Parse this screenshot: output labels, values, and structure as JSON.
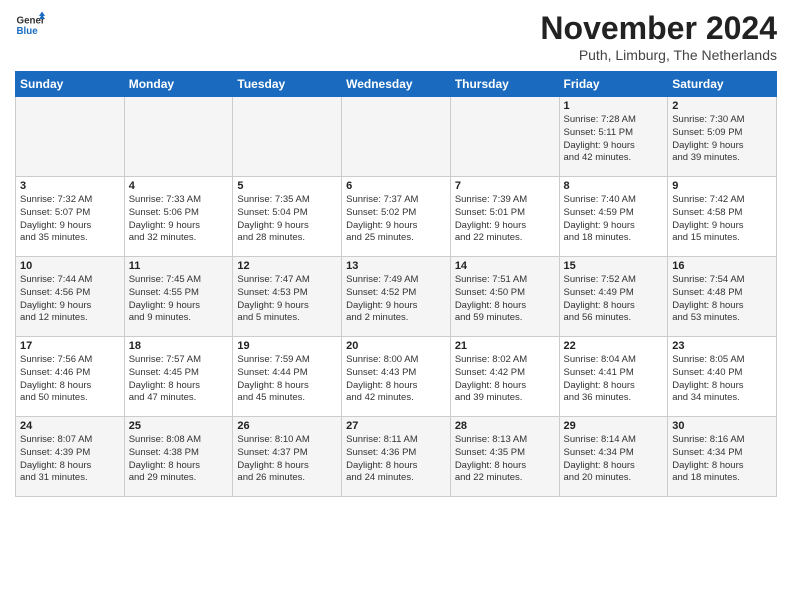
{
  "logo": {
    "line1": "General",
    "line2": "Blue"
  },
  "title": "November 2024",
  "subtitle": "Puth, Limburg, The Netherlands",
  "days_of_week": [
    "Sunday",
    "Monday",
    "Tuesday",
    "Wednesday",
    "Thursday",
    "Friday",
    "Saturday"
  ],
  "weeks": [
    [
      {
        "day": "",
        "info": ""
      },
      {
        "day": "",
        "info": ""
      },
      {
        "day": "",
        "info": ""
      },
      {
        "day": "",
        "info": ""
      },
      {
        "day": "",
        "info": ""
      },
      {
        "day": "1",
        "info": "Sunrise: 7:28 AM\nSunset: 5:11 PM\nDaylight: 9 hours\nand 42 minutes."
      },
      {
        "day": "2",
        "info": "Sunrise: 7:30 AM\nSunset: 5:09 PM\nDaylight: 9 hours\nand 39 minutes."
      }
    ],
    [
      {
        "day": "3",
        "info": "Sunrise: 7:32 AM\nSunset: 5:07 PM\nDaylight: 9 hours\nand 35 minutes."
      },
      {
        "day": "4",
        "info": "Sunrise: 7:33 AM\nSunset: 5:06 PM\nDaylight: 9 hours\nand 32 minutes."
      },
      {
        "day": "5",
        "info": "Sunrise: 7:35 AM\nSunset: 5:04 PM\nDaylight: 9 hours\nand 28 minutes."
      },
      {
        "day": "6",
        "info": "Sunrise: 7:37 AM\nSunset: 5:02 PM\nDaylight: 9 hours\nand 25 minutes."
      },
      {
        "day": "7",
        "info": "Sunrise: 7:39 AM\nSunset: 5:01 PM\nDaylight: 9 hours\nand 22 minutes."
      },
      {
        "day": "8",
        "info": "Sunrise: 7:40 AM\nSunset: 4:59 PM\nDaylight: 9 hours\nand 18 minutes."
      },
      {
        "day": "9",
        "info": "Sunrise: 7:42 AM\nSunset: 4:58 PM\nDaylight: 9 hours\nand 15 minutes."
      }
    ],
    [
      {
        "day": "10",
        "info": "Sunrise: 7:44 AM\nSunset: 4:56 PM\nDaylight: 9 hours\nand 12 minutes."
      },
      {
        "day": "11",
        "info": "Sunrise: 7:45 AM\nSunset: 4:55 PM\nDaylight: 9 hours\nand 9 minutes."
      },
      {
        "day": "12",
        "info": "Sunrise: 7:47 AM\nSunset: 4:53 PM\nDaylight: 9 hours\nand 5 minutes."
      },
      {
        "day": "13",
        "info": "Sunrise: 7:49 AM\nSunset: 4:52 PM\nDaylight: 9 hours\nand 2 minutes."
      },
      {
        "day": "14",
        "info": "Sunrise: 7:51 AM\nSunset: 4:50 PM\nDaylight: 8 hours\nand 59 minutes."
      },
      {
        "day": "15",
        "info": "Sunrise: 7:52 AM\nSunset: 4:49 PM\nDaylight: 8 hours\nand 56 minutes."
      },
      {
        "day": "16",
        "info": "Sunrise: 7:54 AM\nSunset: 4:48 PM\nDaylight: 8 hours\nand 53 minutes."
      }
    ],
    [
      {
        "day": "17",
        "info": "Sunrise: 7:56 AM\nSunset: 4:46 PM\nDaylight: 8 hours\nand 50 minutes."
      },
      {
        "day": "18",
        "info": "Sunrise: 7:57 AM\nSunset: 4:45 PM\nDaylight: 8 hours\nand 47 minutes."
      },
      {
        "day": "19",
        "info": "Sunrise: 7:59 AM\nSunset: 4:44 PM\nDaylight: 8 hours\nand 45 minutes."
      },
      {
        "day": "20",
        "info": "Sunrise: 8:00 AM\nSunset: 4:43 PM\nDaylight: 8 hours\nand 42 minutes."
      },
      {
        "day": "21",
        "info": "Sunrise: 8:02 AM\nSunset: 4:42 PM\nDaylight: 8 hours\nand 39 minutes."
      },
      {
        "day": "22",
        "info": "Sunrise: 8:04 AM\nSunset: 4:41 PM\nDaylight: 8 hours\nand 36 minutes."
      },
      {
        "day": "23",
        "info": "Sunrise: 8:05 AM\nSunset: 4:40 PM\nDaylight: 8 hours\nand 34 minutes."
      }
    ],
    [
      {
        "day": "24",
        "info": "Sunrise: 8:07 AM\nSunset: 4:39 PM\nDaylight: 8 hours\nand 31 minutes."
      },
      {
        "day": "25",
        "info": "Sunrise: 8:08 AM\nSunset: 4:38 PM\nDaylight: 8 hours\nand 29 minutes."
      },
      {
        "day": "26",
        "info": "Sunrise: 8:10 AM\nSunset: 4:37 PM\nDaylight: 8 hours\nand 26 minutes."
      },
      {
        "day": "27",
        "info": "Sunrise: 8:11 AM\nSunset: 4:36 PM\nDaylight: 8 hours\nand 24 minutes."
      },
      {
        "day": "28",
        "info": "Sunrise: 8:13 AM\nSunset: 4:35 PM\nDaylight: 8 hours\nand 22 minutes."
      },
      {
        "day": "29",
        "info": "Sunrise: 8:14 AM\nSunset: 4:34 PM\nDaylight: 8 hours\nand 20 minutes."
      },
      {
        "day": "30",
        "info": "Sunrise: 8:16 AM\nSunset: 4:34 PM\nDaylight: 8 hours\nand 18 minutes."
      }
    ]
  ]
}
